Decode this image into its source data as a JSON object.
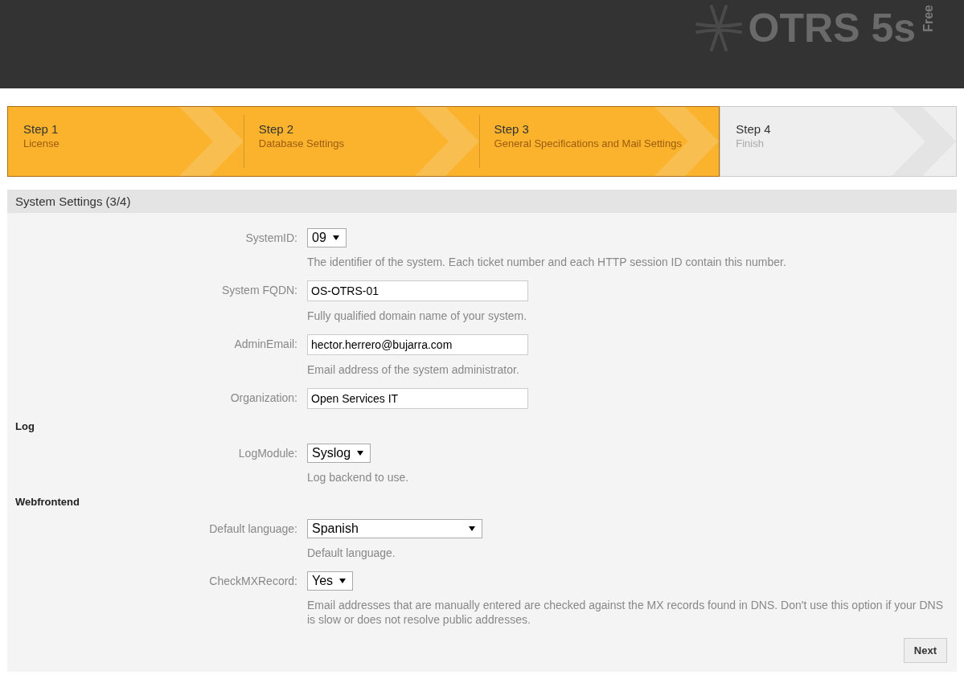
{
  "logo": {
    "name": "OTRS 5s",
    "edition": "Free"
  },
  "steps": [
    {
      "title": "Step 1",
      "subtitle": "License",
      "completed": true
    },
    {
      "title": "Step 2",
      "subtitle": "Database Settings",
      "completed": true
    },
    {
      "title": "Step 3",
      "subtitle": "General Specifications and Mail Settings",
      "completed": true
    },
    {
      "title": "Step 4",
      "subtitle": "Finish",
      "completed": false
    }
  ],
  "panel": {
    "title": "System Settings (3/4)",
    "items": [
      {
        "kind": "select",
        "label": "SystemID:",
        "value": "09",
        "help": "The identifier of the system. Each ticket number and each HTTP session ID contain this number."
      },
      {
        "kind": "text",
        "label": "System FQDN:",
        "value": "OS-OTRS-01",
        "help": "Fully qualified domain name of your system."
      },
      {
        "kind": "text",
        "label": "AdminEmail:",
        "value": "hector.herrero@bujarra.com",
        "help": "Email address of the system administrator."
      },
      {
        "kind": "text",
        "label": "Organization:",
        "value": "Open Services IT"
      },
      {
        "kind": "heading",
        "label": "Log"
      },
      {
        "kind": "select",
        "label": "LogModule:",
        "value": "Syslog",
        "help": "Log backend to use."
      },
      {
        "kind": "heading",
        "label": "Webfrontend"
      },
      {
        "kind": "select",
        "label": "Default language:",
        "value": "Spanish",
        "wide": true,
        "help": "Default language."
      },
      {
        "kind": "select",
        "label": "CheckMXRecord:",
        "value": "Yes",
        "help": "Email addresses that are manually entered are checked against the MX records found in DNS. Don't use this option if your DNS is slow or does not resolve public addresses."
      }
    ],
    "next_button": "Next"
  }
}
